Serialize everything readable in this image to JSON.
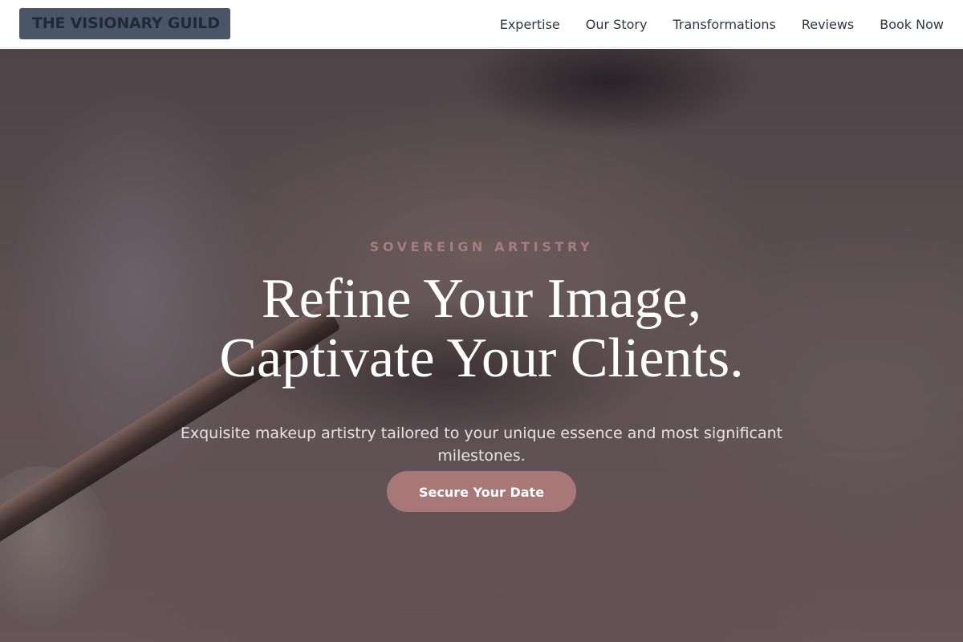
{
  "nav": {
    "logo": "THE VISIONARY GUILD",
    "links": [
      "Expertise",
      "Our Story",
      "Transformations",
      "Reviews",
      "Book Now"
    ]
  },
  "hero": {
    "eyebrow": "SOVEREIGN ARTISTRY",
    "headline_line1": "Refine Your Image,",
    "headline_line2": "Captivate Your Clients.",
    "subtext": "Exquisite makeup artistry tailored to your unique essence and most significant milestones.",
    "cta_label": "Secure Your Date"
  },
  "colors": {
    "logo_bg": "#4a5568",
    "accent": "#a87878",
    "eyebrow": "#a87e7d"
  }
}
